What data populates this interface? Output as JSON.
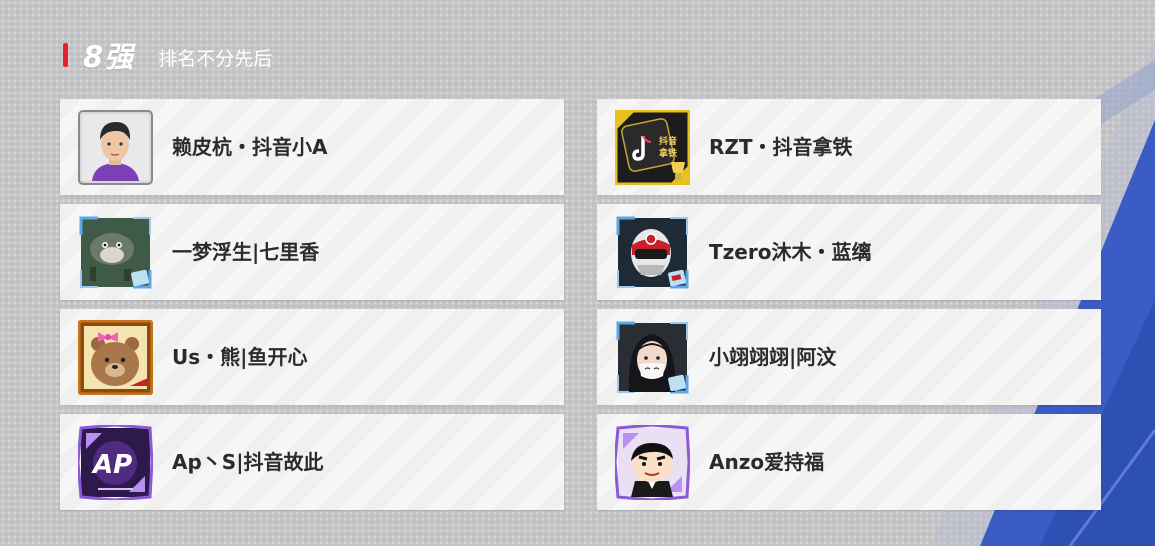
{
  "header": {
    "title": "8强",
    "subtitle": "排名不分先后"
  },
  "players": [
    {
      "name": "赖皮杭・抖音小A",
      "avatar_icon": "player-photo-avatar-icon",
      "frame_color": "#8a8a8a"
    },
    {
      "name": "RZT・抖音拿铁",
      "avatar_icon": "douyin-latte-trophy-avatar-icon",
      "frame_color": "#e8c020"
    },
    {
      "name": "一梦浮生|七里香",
      "avatar_icon": "forest-spirit-avatar-icon",
      "frame_color": "#5aa8e8"
    },
    {
      "name": "Tzero沐木・蓝缡",
      "avatar_icon": "racing-helmet-avatar-icon",
      "frame_color": "#5aa8e8"
    },
    {
      "name": "Us・熊|鱼开心",
      "avatar_icon": "brown-bear-avatar-icon",
      "frame_color": "#c8741c"
    },
    {
      "name": "小翊翊翊|阿汶",
      "avatar_icon": "masked-girl-avatar-icon",
      "frame_color": "#5aa8e8"
    },
    {
      "name": "Ap丶S|抖音故此",
      "avatar_icon": "ap-logo-avatar-icon",
      "frame_color": "#8a5ad8"
    },
    {
      "name": "Anzo爱持福",
      "avatar_icon": "cartoon-boy-avatar-icon",
      "frame_color": "#8a5ad8"
    }
  ]
}
